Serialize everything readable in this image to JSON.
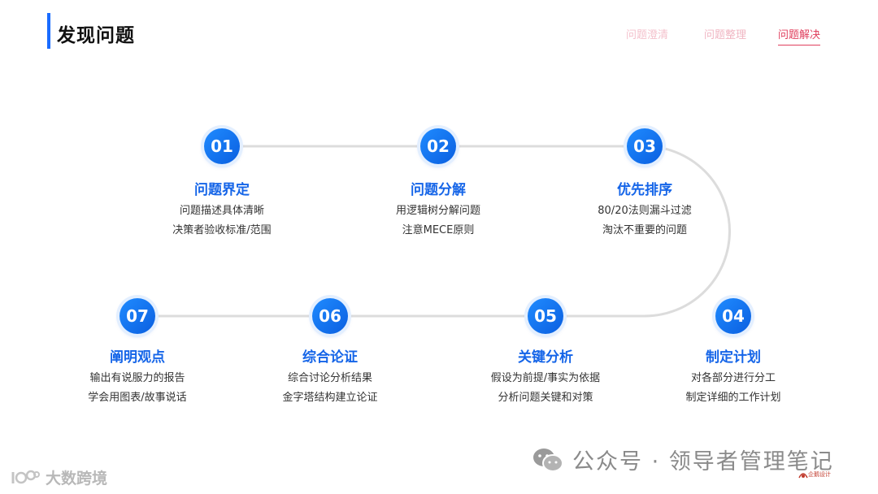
{
  "header": {
    "title": "发现问题",
    "tabs": [
      "问题澄清",
      "问题整理",
      "问题解决"
    ]
  },
  "steps": [
    {
      "num": "01",
      "title": "问题界定",
      "lines": [
        "问题描述具体清晰",
        "决策者验收标准/范围"
      ]
    },
    {
      "num": "02",
      "title": "问题分解",
      "lines": [
        "用逻辑树分解问题",
        "注意MECE原则"
      ]
    },
    {
      "num": "03",
      "title": "优先排序",
      "lines": [
        "80/20法则漏斗过滤",
        "淘汰不重要的问题"
      ]
    },
    {
      "num": "04",
      "title": "制定计划",
      "lines": [
        "对各部分进行分工",
        "制定详细的工作计划"
      ]
    },
    {
      "num": "05",
      "title": "关键分析",
      "lines": [
        "假设为前提/事实为依据",
        "分析问题关键和对策"
      ]
    },
    {
      "num": "06",
      "title": "综合论证",
      "lines": [
        "综合讨论分析结果",
        "金字塔结构建立论证"
      ]
    },
    {
      "num": "07",
      "title": "阐明观点",
      "lines": [
        "输出有说服力的报告",
        "学会用图表/故事说话"
      ]
    }
  ],
  "watermarks": {
    "right": "公众号 · 领导者管理笔记",
    "left": "大数跨境",
    "corner": "企鹅设计"
  },
  "colors": {
    "accent": "#1a6cff",
    "node": "#1565e8",
    "tab_active": "#e0405e",
    "track": "#dcdcdc"
  }
}
